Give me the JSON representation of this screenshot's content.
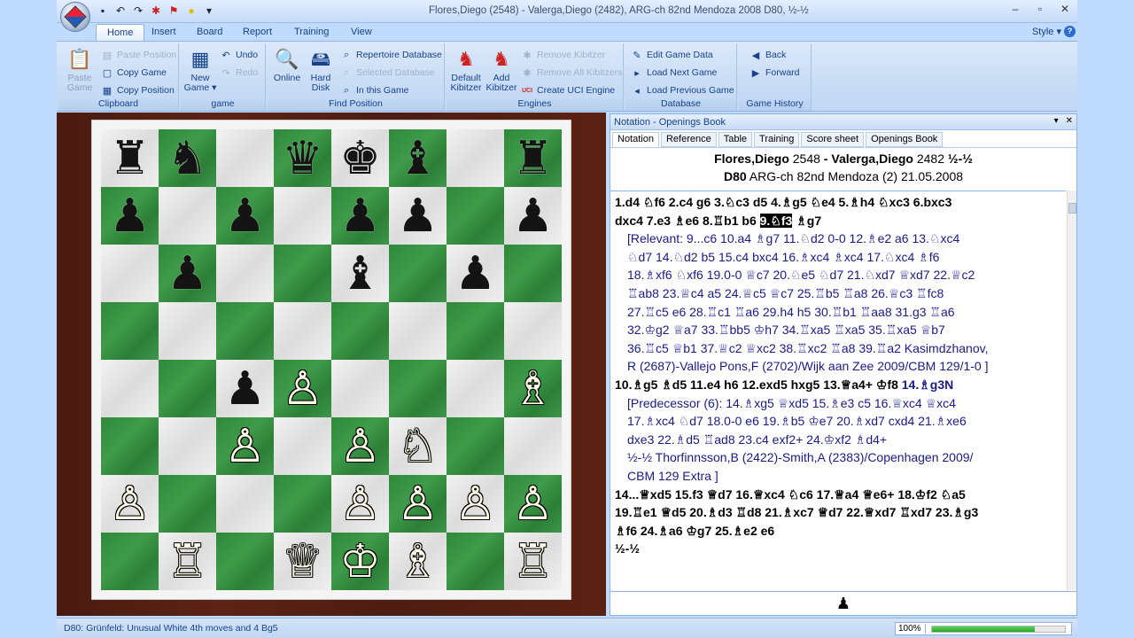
{
  "window": {
    "title": "Flores,Diego (2548) - Valerga,Diego (2482), ARG-ch 82nd Mendoza 2008  D80, ½-½",
    "minimize": "–",
    "maximize": "▫",
    "close": "✕"
  },
  "ribbon": {
    "tabs": [
      "Home",
      "Insert",
      "Board",
      "Report",
      "Training",
      "View"
    ],
    "style_label": "Style ▾",
    "help": "?",
    "clipboard": {
      "label": "Clipboard",
      "paste_game": "Paste Game",
      "paste_position": "Paste Position",
      "copy_game": "Copy Game",
      "copy_position": "Copy Position"
    },
    "game": {
      "label": "game",
      "new_game": "New Game ▾",
      "undo": "Undo",
      "redo": "Redo"
    },
    "find_position": {
      "label": "Find Position",
      "online": "Online",
      "hard_disk": "Hard Disk",
      "repertoire_db": "Repertoire Database",
      "selected_db": "Selected Database",
      "in_this_game": "In this Game"
    },
    "engines": {
      "label": "Engines",
      "default_kibitzer": "Default Kibitzer",
      "add_kibitzer": "Add Kibitzer",
      "remove_kibitzer": "Remove Kibitzer",
      "remove_all_kibitzers": "Remove All Kibitzers",
      "create_uci_engine": "Create UCI Engine"
    },
    "database": {
      "label": "Database",
      "edit_game_data": "Edit Game Data",
      "load_next_game": "Load Next Game",
      "load_previous_game": "Load Previous Game"
    },
    "game_history": {
      "label": "Game History",
      "back": "Back",
      "forward": "Forward"
    }
  },
  "board": {
    "ranks": [
      [
        "♜",
        "♞",
        "",
        "♛",
        "♚",
        "♝",
        "",
        "♜"
      ],
      [
        "♟",
        "",
        "♟",
        "",
        "♟",
        "♟",
        "",
        "♟"
      ],
      [
        "",
        "♟",
        "",
        "",
        "♝",
        "",
        "♟",
        ""
      ],
      [
        "",
        "",
        "",
        "",
        "",
        "",
        "",
        ""
      ],
      [
        "",
        "",
        "♟",
        "♙",
        "",
        "",
        "",
        "♗"
      ],
      [
        "",
        "",
        "♙",
        "",
        "♙",
        "♘",
        "",
        ""
      ],
      [
        "♙",
        "",
        "",
        "",
        "♙",
        "♙",
        "♙",
        "♙"
      ],
      [
        "",
        "♖",
        "",
        "♕",
        "♔",
        "♗",
        "",
        "♖"
      ]
    ],
    "colors": [
      [
        "b",
        "b",
        "",
        "b",
        "b",
        "b",
        "",
        "b"
      ],
      [
        "b",
        "",
        "b",
        "",
        "b",
        "b",
        "",
        "b"
      ],
      [
        "",
        "b",
        "",
        "",
        "b",
        "",
        "b",
        ""
      ],
      [
        "",
        "",
        "",
        "",
        "",
        "",
        "",
        ""
      ],
      [
        "",
        "",
        "b",
        "w",
        "",
        "",
        "",
        "w"
      ],
      [
        "",
        "",
        "w",
        "",
        "w",
        "w",
        "",
        ""
      ],
      [
        "w",
        "",
        "",
        "",
        "w",
        "w",
        "w",
        "w"
      ],
      [
        "",
        "w",
        "",
        "w",
        "w",
        "w",
        "",
        "w"
      ]
    ]
  },
  "notation": {
    "panel_title": "Notation - Openings Book",
    "pin": "▾",
    "close": "✕",
    "tabs": [
      "Notation",
      "Reference",
      "Table",
      "Training",
      "Score sheet",
      "Openings Book"
    ],
    "header": {
      "white": "Flores,Diego",
      "white_elo": "2548",
      "dash": " -",
      "black": "Valerga,Diego",
      "black_elo": "2482",
      "result": "½-½",
      "eco": "D80",
      "event": "ARG-ch 82nd Mendoza (2) 21.05.2008"
    },
    "lines": [
      {
        "type": "main",
        "text_a": "1.d4  ♘f6  2.c4  g6  3.♘c3  d5  4.♗g5  ♘e4  5.♗h4  ♘xc3  6.bxc3"
      },
      {
        "type": "main_cur",
        "text_a": "dxc4  7.e3  ♗e6  8.♖b1  b6  ",
        "cur": "9.♘f3",
        "text_b": "  ♗g7"
      },
      {
        "type": "var",
        "text_a": "[Relevant:  9...c6  10.a4  ♗g7  11.♘d2  0-0  12.♗e2  a6  13.♘xc4"
      },
      {
        "type": "var",
        "text_a": "♘d7  14.♘d2  b5  15.c4  bxc4  16.♗xc4  ♗xc4  17.♘xc4  ♗f6"
      },
      {
        "type": "var",
        "text_a": "18.♗xf6  ♘xf6  19.0-0  ♕c7  20.♘e5  ♘d7  21.♘xd7  ♕xd7  22.♕c2"
      },
      {
        "type": "var",
        "text_a": "♖ab8  23.♕c4  a5  24.♕c5  ♕c7  25.♖b5  ♖a8  26.♕c3  ♖fc8"
      },
      {
        "type": "var",
        "text_a": "27.♖c5  e6  28.♖c1  ♖a6  29.h4  h5  30.♖b1  ♖aa8  31.g3  ♖a6"
      },
      {
        "type": "var",
        "text_a": "32.♔g2  ♕a7  33.♖bb5  ♔h7  34.♖xa5  ♖xa5  35.♖xa5  ♕b7"
      },
      {
        "type": "var",
        "text_a": "36.♖c5  ♕b1  37.♕c2  ♕xc2  38.♖xc2  ♖a8  39.♖a2  Kasimdzhanov,"
      },
      {
        "type": "var",
        "text_a": "R (2687)-Vallejo Pons,F (2702)/Wijk aan Zee 2009/CBM 129/1-0 ]"
      },
      {
        "type": "main_blue",
        "text_a": "10.♗g5  ♗d5  11.e4  h6  12.exd5  hxg5  13.♕a4+  ♔f8  ",
        "blue": "14.♗g3N"
      },
      {
        "type": "var",
        "text_a": "[Predecessor (6):  14.♗xg5  ♕xd5  15.♗e3  c5  16.♕xc4  ♕xc4"
      },
      {
        "type": "var",
        "text_a": "17.♗xc4  ♘d7  18.0-0  e6  19.♗b5  ♔e7  20.♗xd7  cxd4  21.♗xe6"
      },
      {
        "type": "var",
        "text_a": "dxe3  22.♗d5  ♖ad8  23.c4  exf2+  24.♔xf2  ♗d4+"
      },
      {
        "type": "var",
        "text_a": "½-½  Thorfinnsson,B (2422)-Smith,A (2383)/Copenhagen 2009/"
      },
      {
        "type": "var",
        "text_a": "CBM 129 Extra ]"
      },
      {
        "type": "main",
        "text_a": "14...♕xd5  15.f3  ♕d7  16.♕xc4  ♘c6  17.♕a4  ♕e6+  18.♔f2  ♘a5"
      },
      {
        "type": "main",
        "text_a": "19.♖e1  ♕d5  20.♗d3  ♖d8  21.♗xc7  ♕d7  22.♕xd7  ♖xd7  23.♗g3"
      },
      {
        "type": "main",
        "text_a": "♗f6  24.♗a6  ♔g7  25.♗e2  e6"
      },
      {
        "type": "main",
        "text_a": "½-½"
      }
    ],
    "footer_piece": "♟"
  },
  "status": {
    "text": "D80: Grünfeld: Unusual White 4th moves and 4 Bg5",
    "zoom": "100%",
    "progress": 0.77
  }
}
